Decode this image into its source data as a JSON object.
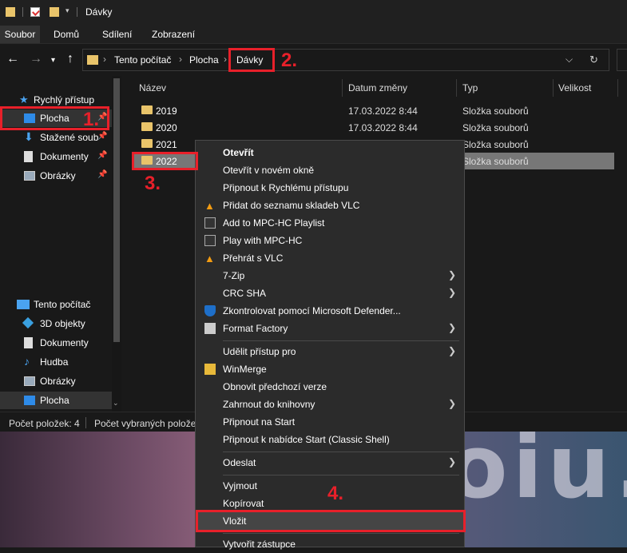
{
  "window": {
    "title": "Dávky"
  },
  "ribbon": {
    "tabs": [
      "Soubor",
      "Domů",
      "Sdílení",
      "Zobrazení"
    ]
  },
  "address": {
    "crumbs": [
      "Tento počítač",
      "Plocha",
      "Dávky"
    ]
  },
  "sidebar": {
    "quick_access": "Rychlý přístup",
    "items": [
      {
        "label": "Plocha"
      },
      {
        "label": "Stažené soub"
      },
      {
        "label": "Dokumenty"
      },
      {
        "label": "Obrázky"
      }
    ],
    "this_pc": "Tento počítač",
    "pc_items": [
      {
        "label": "3D objekty"
      },
      {
        "label": "Dokumenty"
      },
      {
        "label": "Hudba"
      },
      {
        "label": "Obrázky"
      },
      {
        "label": "Plocha"
      }
    ]
  },
  "filelist": {
    "columns": [
      "Název",
      "Datum změny",
      "Typ",
      "Velikost"
    ],
    "rows": [
      {
        "name": "2019",
        "date": "17.03.2022 8:44",
        "type": "Složka souborů"
      },
      {
        "name": "2020",
        "date": "17.03.2022 8:44",
        "type": "Složka souborů"
      },
      {
        "name": "2021",
        "date": "",
        "type": "Složka souborů"
      },
      {
        "name": "2022",
        "date": "",
        "type": "Složka souborů"
      }
    ]
  },
  "status": {
    "count": "Počet položek: 4",
    "selected": "Počet vybraných polože"
  },
  "desktop_text": "oiu.",
  "context_menu": {
    "items": [
      "Otevřít",
      "Otevřít v novém okně",
      "Připnout k Rychlému přístupu",
      "Přidat do seznamu skladeb VLC",
      "Add to MPC-HC Playlist",
      "Play with MPC-HC",
      "Přehrát s VLC",
      "7-Zip",
      "CRC SHA",
      "Zkontrolovat pomocí Microsoft Defender...",
      "Format Factory",
      "Udělit přístup pro",
      "WinMerge",
      "Obnovit předchozí verze",
      "Zahrnout do knihovny",
      "Připnout na Start",
      "Připnout k nabídce Start (Classic Shell)",
      "Odeslat",
      "Vyjmout",
      "Kopírovat",
      "Vložit",
      "Vytvořit zástupce"
    ]
  },
  "annotations": [
    "1.",
    "2.",
    "3.",
    "4."
  ],
  "colors": {
    "accent_red": "#e8202a",
    "folder": "#e9c46a",
    "selection": "#777777"
  }
}
